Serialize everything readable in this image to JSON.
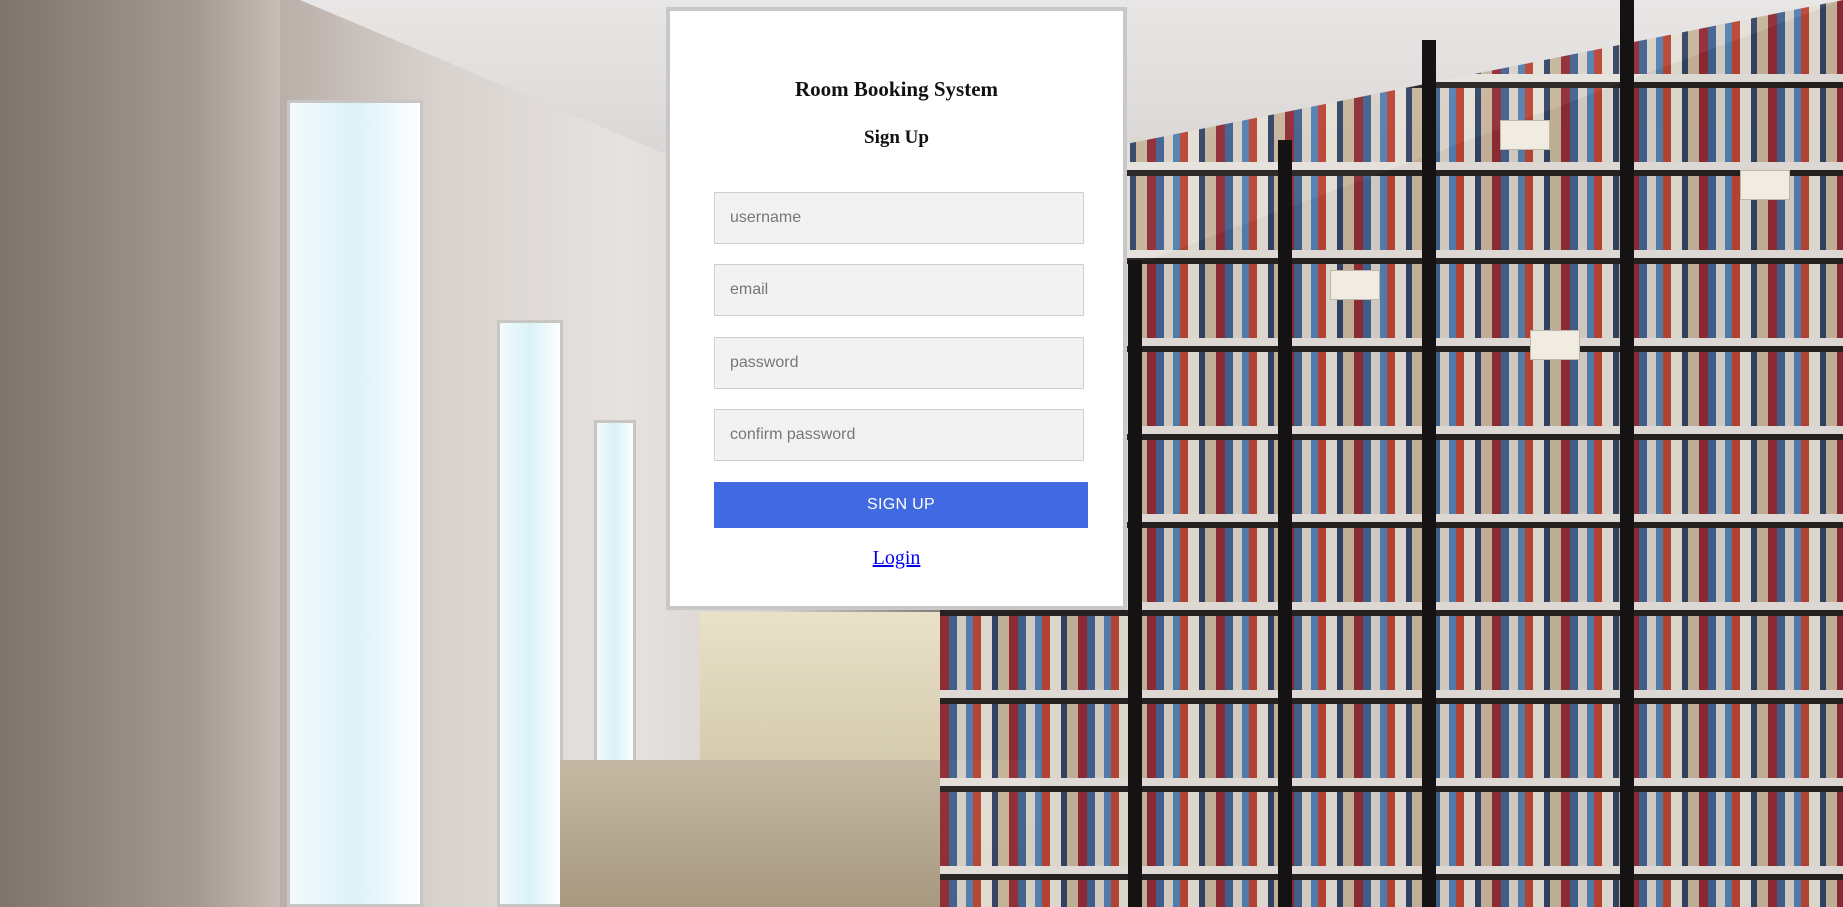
{
  "card": {
    "title": "Room Booking System",
    "subtitle": "Sign Up",
    "fields": {
      "username": {
        "placeholder": "username",
        "value": ""
      },
      "email": {
        "placeholder": "email",
        "value": ""
      },
      "password": {
        "placeholder": "password",
        "value": ""
      },
      "confirm_password": {
        "placeholder": "confirm password",
        "value": ""
      }
    },
    "signup_button_label": "SIGN UP",
    "login_link_label": "Login"
  },
  "colors": {
    "accent": "#4169e1",
    "link": "#0000ee",
    "card_border": "#c8c8c8",
    "field_background": "#f2f2f2"
  }
}
